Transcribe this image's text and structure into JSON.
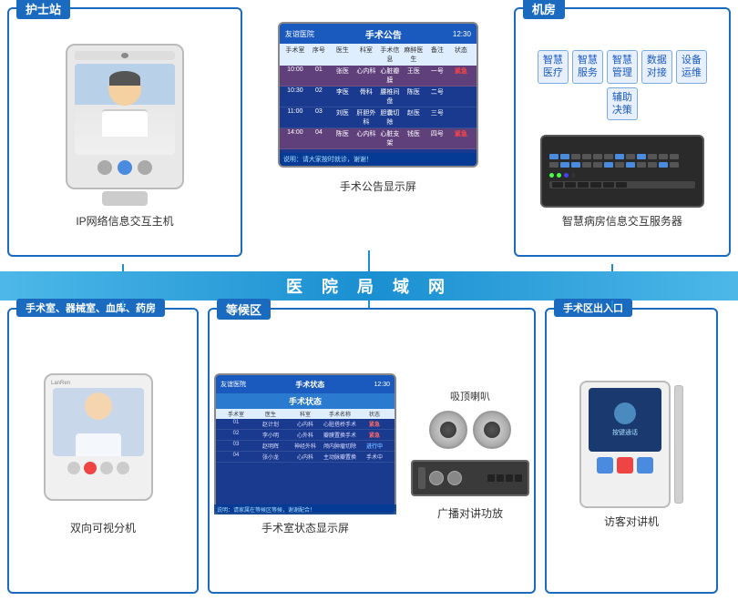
{
  "sections": {
    "nurse_station": "护士站",
    "machine_room": "机房",
    "surgery_rooms": "手术室、器械室、血库、药房",
    "waiting_area": "等候区",
    "surgery_entrance": "手术区出入口"
  },
  "network": {
    "label": "医 院 局 域 网"
  },
  "devices": {
    "ip_host": "IP网络信息交互主机",
    "surgery_announce_screen": "手术公告显示屏",
    "server": "智慧病房信息交互服务器",
    "bidir_monitor": "双向可视分机",
    "surgery_status_screen": "手术室状态显示屏",
    "speaker_ceiling": "吸顶喇叭",
    "broadcast_amp": "广播对讲功放",
    "visitor_intercom": "访客对讲机"
  },
  "modules": [
    {
      "label": "智慧\n医疗"
    },
    {
      "label": "智慧\n服务"
    },
    {
      "label": "智慧\n管理"
    },
    {
      "label": "数据\n对接"
    },
    {
      "label": "设备\n运维"
    },
    {
      "label": "辅助\n决策"
    }
  ],
  "announce_screen": {
    "hospital": "友谊医院",
    "title": "手术公告",
    "time": "12:30",
    "cols": [
      "手术室",
      "序号",
      "医生",
      "科室",
      "手术信息",
      "麻醉医生",
      "备注",
      "状态"
    ],
    "rows": [
      [
        "10:00",
        "01",
        "张医师",
        "心内科",
        "心脏瓣膜修复手术",
        "王医",
        "一号",
        "紧急"
      ],
      [
        "10:30",
        "02",
        "李医师",
        "骨科",
        "腰椎间盘摘除术",
        "陈医",
        "二号",
        ""
      ],
      [
        "11:00",
        "03",
        "刘医师",
        "肝胆外科",
        "胆囊切除术",
        "赵医",
        "三号",
        ""
      ],
      [
        "14:00",
        "04",
        "陈医师",
        "心内科",
        "心脏支架手术",
        "钱医",
        "四号",
        "紧急"
      ]
    ]
  },
  "status_screen": {
    "hospital": "友谊医院",
    "title": "手术状态",
    "time": "12:30",
    "cols": [
      "手术室",
      "医生",
      "科室",
      "手术名称",
      "状态"
    ],
    "rows": [
      [
        "01",
        "赵计划",
        "心内科",
        "心脏搭桥手术",
        "紧急"
      ],
      [
        "02",
        "李小明",
        "心外科",
        "瓣膜置换手术",
        "紧急"
      ],
      [
        "03",
        "赵明辉",
        "神经外科",
        "颅内肿瘤切除",
        "进行中"
      ],
      [
        "04",
        "张小龙",
        "心内科",
        "主动脉瓣置换",
        "手术中"
      ]
    ]
  },
  "brand": "LanRen"
}
